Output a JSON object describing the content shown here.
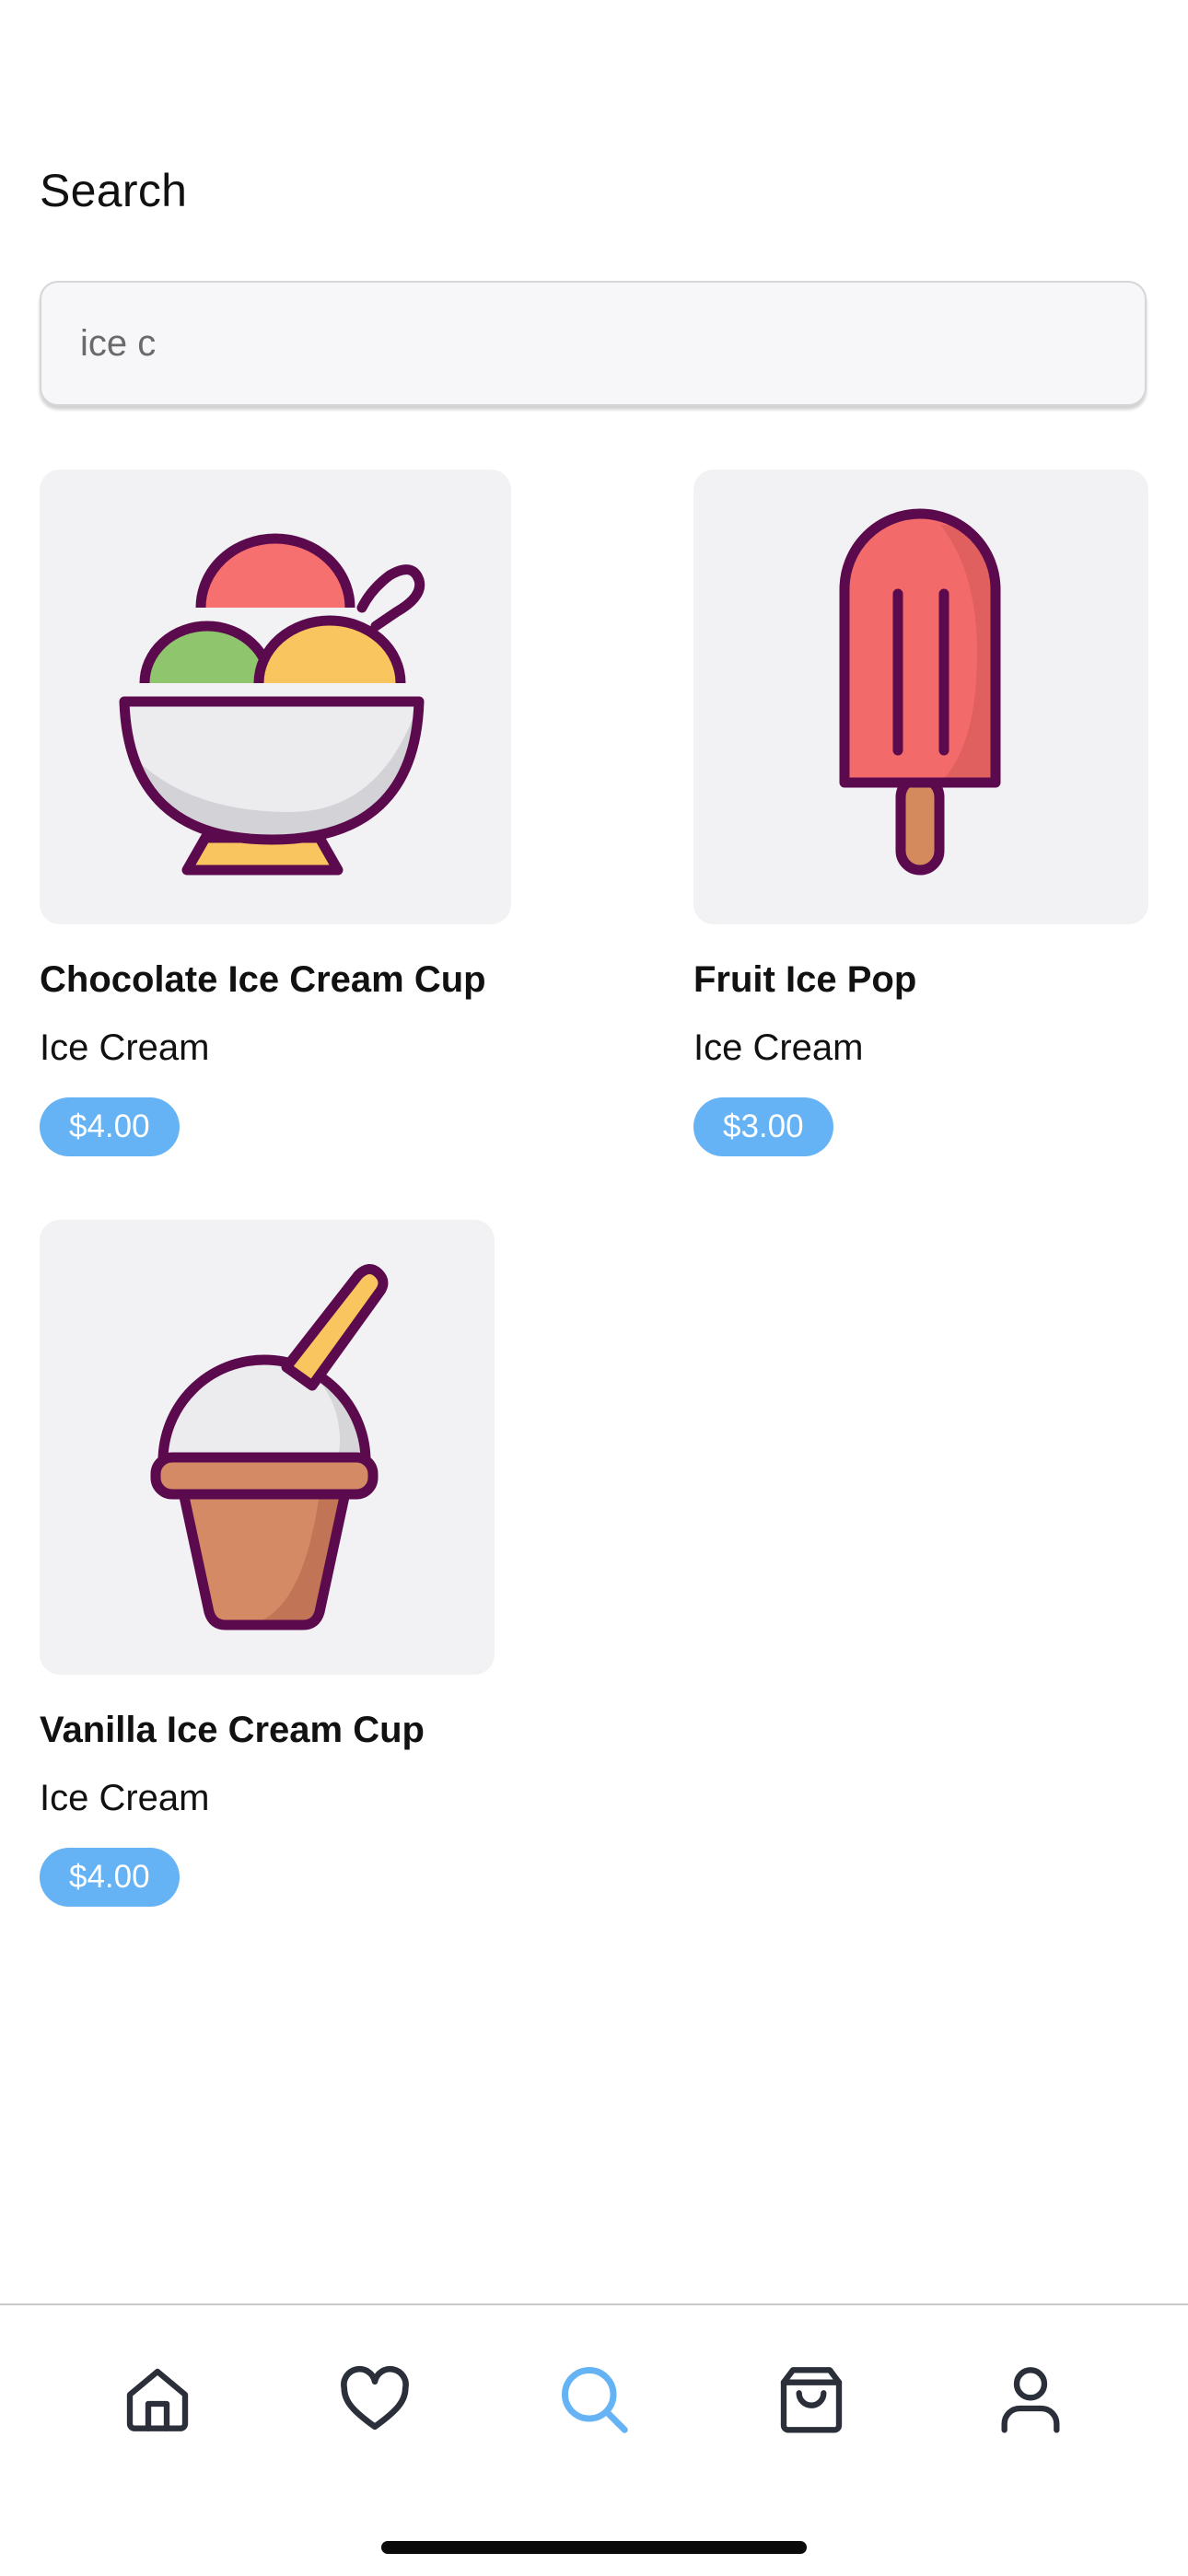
{
  "header": {
    "title": "Search"
  },
  "search": {
    "value": "ice c",
    "placeholder": ""
  },
  "results": [
    {
      "name": "Chocolate Ice Cream Cup",
      "category": "Ice Cream",
      "price": "$4.00",
      "icon": "ice-cream-bowl-icon"
    },
    {
      "name": "Fruit Ice Pop",
      "category": "Ice Cream",
      "price": "$3.00",
      "icon": "ice-pop-icon"
    },
    {
      "name": "Vanilla Ice Cream Cup",
      "category": "Ice Cream",
      "price": "$4.00",
      "icon": "ice-cream-cup-icon"
    }
  ],
  "nav": {
    "items": [
      "home-icon",
      "heart-icon",
      "search-icon",
      "shopping-bag-icon",
      "user-icon"
    ],
    "active": "search-icon",
    "active_color": "#65b3f5",
    "inactive_color": "#2b2f3a"
  },
  "colors": {
    "price_badge": "#65b3f5",
    "outline": "#5c0a4e",
    "card_bg": "#f2f2f4"
  }
}
